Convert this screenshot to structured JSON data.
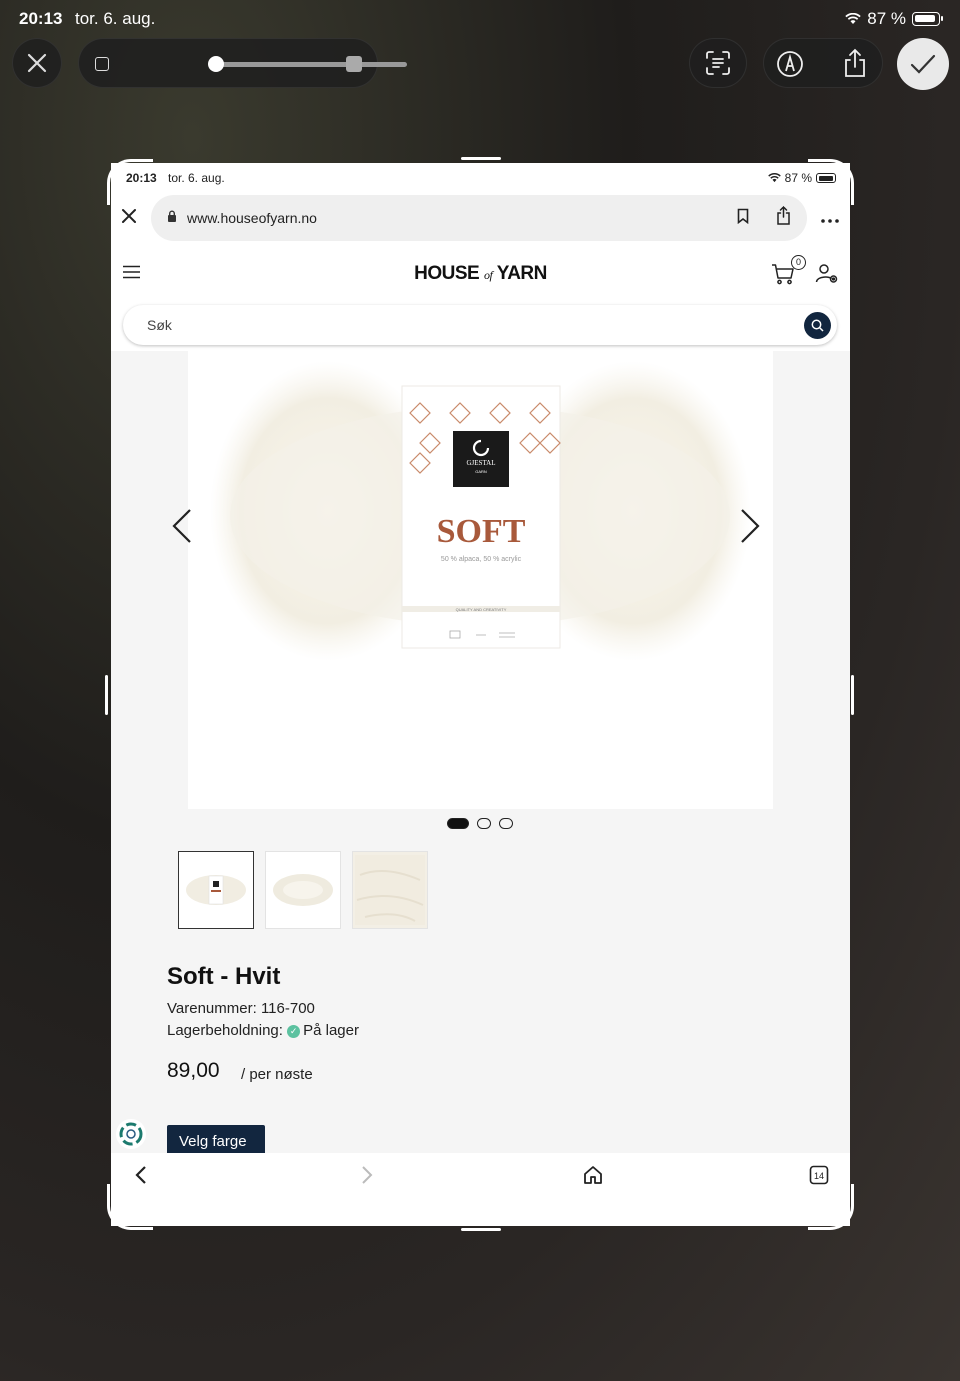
{
  "outer_status": {
    "time": "20:13",
    "date": "tor. 6. aug.",
    "battery": "87 %"
  },
  "editor": {
    "close_icon": "close-icon",
    "done_icon": "checkmark-icon"
  },
  "inner_status": {
    "time": "20:13",
    "date": "tor. 6. aug.",
    "battery": "87 %"
  },
  "browser": {
    "url": "www.houseofyarn.no",
    "tabs_count": "14"
  },
  "site": {
    "logo_left": "HOUSE",
    "logo_of": "of",
    "logo_right": "YARN",
    "cart_count": "0",
    "search_placeholder": "Søk"
  },
  "product": {
    "label_brand": "GJESTAL",
    "label_sub": "GARN",
    "label_name": "SOFT",
    "label_fiber": "50 % alpaca, 50 % acrylic",
    "label_quality": "QUALITY AND CREATIVITY",
    "title": "Soft - Hvit",
    "sku_label": "Varenummer:",
    "sku": "116-700",
    "stock_label": "Lagerbeholdning:",
    "stock": "På lager",
    "price": "89,00",
    "unit": "/ per nøste",
    "color_button": "Velg farge"
  },
  "gallery": {
    "slides": 3,
    "active": 1
  }
}
